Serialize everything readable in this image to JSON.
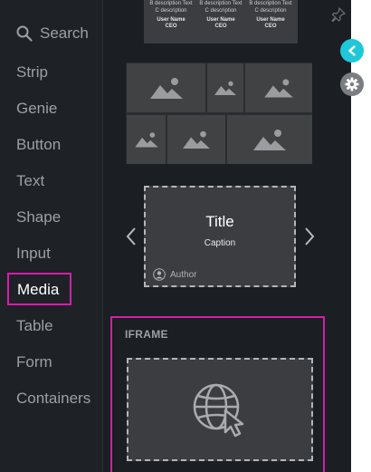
{
  "search": {
    "label": "Search"
  },
  "nav": {
    "items": [
      {
        "label": "Strip"
      },
      {
        "label": "Genie"
      },
      {
        "label": "Button"
      },
      {
        "label": "Text"
      },
      {
        "label": "Shape"
      },
      {
        "label": "Input"
      },
      {
        "label": "Media"
      },
      {
        "label": "Table"
      },
      {
        "label": "Form"
      },
      {
        "label": "Containers"
      }
    ],
    "active": "Media"
  },
  "testimonial": {
    "columns": [
      {
        "desc1": "B description Text",
        "desc2": "C description",
        "name": "User Name",
        "role": "CEO"
      },
      {
        "desc1": "B description Text",
        "desc2": "C description",
        "name": "User Name",
        "role": "CEO"
      },
      {
        "desc1": "B description Text",
        "desc2": "C description",
        "name": "User Name",
        "role": "CEO"
      }
    ]
  },
  "card": {
    "title": "Title",
    "caption": "Caption",
    "author": "Author"
  },
  "iframe": {
    "label": "IFRAME"
  },
  "colors": {
    "accent_highlight": "#d21fa8",
    "collapse_button": "#1fc8d9",
    "background": "#1b1e22"
  },
  "icons": {
    "search": "search-icon",
    "image": "image-icon",
    "globe_cursor": "globe-cursor-icon",
    "user": "user-icon",
    "pin": "pin-icon",
    "chevron_left": "chevron-left-icon",
    "chevron_right": "chevron-right-icon",
    "gear": "gear-icon"
  }
}
